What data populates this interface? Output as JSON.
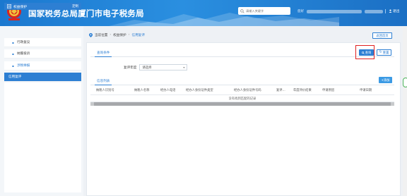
{
  "header": {
    "title": "国家税务总局厦门市电子税务局",
    "search_placeholder": "请输入关键字",
    "user_prefix": "您好",
    "logout_label": "退出"
  },
  "sidebar": {
    "panel_title": "权益保护",
    "panel_action": "定制",
    "items": [
      {
        "label": "行政复议",
        "type": "item"
      },
      {
        "label": "纳服投诉",
        "type": "item"
      },
      {
        "label": "涉税举报",
        "type": "section"
      },
      {
        "label": "信用复评",
        "type": "active"
      }
    ]
  },
  "breadcrumb": {
    "prefix": "当前位置",
    "items": [
      "权益保护",
      "信用复评"
    ]
  },
  "back_button": "返回首页",
  "query_tab": "查询条件",
  "query_button": "查询",
  "reset_button": "重置",
  "form": {
    "year_label": "复评年度",
    "year_value": "请选择"
  },
  "list_tab": "信息列表",
  "add_button": "+添加",
  "table": {
    "columns": [
      "纳税人识别号",
      "纳税人名称",
      "经办人电话",
      "经办人身份证件类型",
      "经办人身份证件号码",
      "复评...",
      "年度评价结果",
      "申请原因",
      "申请日期"
    ],
    "empty_text": "没有找到匹配的记录"
  },
  "colors": {
    "primary": "#2d7fd3",
    "header_bg": "#1b78cf",
    "highlight": "#e02020"
  }
}
